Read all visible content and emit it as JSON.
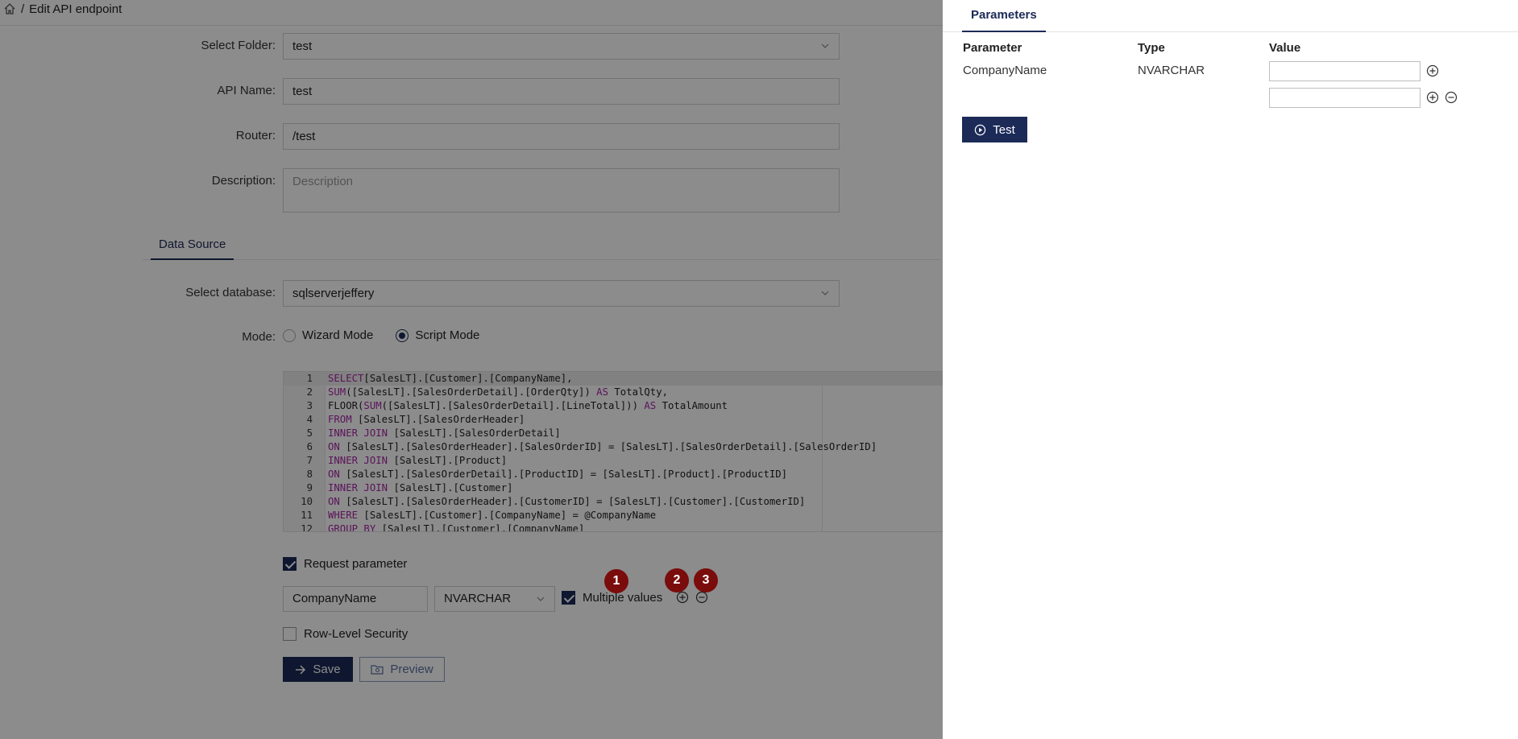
{
  "breadcrumb": {
    "separator": "/",
    "current": "Edit API endpoint"
  },
  "form": {
    "folder": {
      "label": "Select Folder",
      "value": "test"
    },
    "api_name": {
      "label": "API Name",
      "value": "test"
    },
    "router": {
      "label": "Router",
      "value": "/test"
    },
    "description": {
      "label": "Description",
      "placeholder": "Description"
    },
    "tab": "Data Source",
    "database": {
      "label": "Select database",
      "value": "sqlserverjeffery"
    },
    "mode": {
      "label": "Mode",
      "options": [
        "Wizard Mode",
        "Script Mode"
      ],
      "selected": "Script Mode"
    }
  },
  "code": {
    "lines": [
      {
        "n": "1",
        "parts": [
          [
            "kw",
            "SELECT"
          ],
          [
            "",
            "[SalesLT].[Customer].[CompanyName],"
          ]
        ]
      },
      {
        "n": "2",
        "parts": [
          [
            "kw",
            "SUM"
          ],
          [
            "",
            "([SalesLT].[SalesOrderDetail].[OrderQty]) "
          ],
          [
            "kw",
            "AS"
          ],
          [
            "",
            " TotalQty,"
          ]
        ]
      },
      {
        "n": "3",
        "parts": [
          [
            "",
            "FLOOR("
          ],
          [
            "kw",
            "SUM"
          ],
          [
            "",
            "([SalesLT].[SalesOrderDetail].[LineTotal])) "
          ],
          [
            "kw",
            "AS"
          ],
          [
            "",
            " TotalAmount"
          ]
        ]
      },
      {
        "n": "4",
        "parts": [
          [
            "kw",
            "FROM"
          ],
          [
            "",
            " [SalesLT].[SalesOrderHeader]"
          ]
        ]
      },
      {
        "n": "5",
        "parts": [
          [
            "kw",
            "INNER JOIN"
          ],
          [
            "",
            " [SalesLT].[SalesOrderDetail]"
          ]
        ]
      },
      {
        "n": "6",
        "parts": [
          [
            "kw",
            "ON"
          ],
          [
            "",
            " [SalesLT].[SalesOrderHeader].[SalesOrderID] = [SalesLT].[SalesOrderDetail].[SalesOrderID]"
          ]
        ]
      },
      {
        "n": "7",
        "parts": [
          [
            "kw",
            "INNER JOIN"
          ],
          [
            "",
            " [SalesLT].[Product]"
          ]
        ]
      },
      {
        "n": "8",
        "parts": [
          [
            "kw",
            "ON"
          ],
          [
            "",
            " [SalesLT].[SalesOrderDetail].[ProductID] = [SalesLT].[Product].[ProductID]"
          ]
        ]
      },
      {
        "n": "9",
        "parts": [
          [
            "kw",
            "INNER JOIN"
          ],
          [
            "",
            " [SalesLT].[Customer]"
          ]
        ]
      },
      {
        "n": "10",
        "parts": [
          [
            "kw",
            "ON"
          ],
          [
            "",
            " [SalesLT].[SalesOrderHeader].[CustomerID] = [SalesLT].[Customer].[CustomerID]"
          ]
        ]
      },
      {
        "n": "11",
        "parts": [
          [
            "kw",
            "WHERE"
          ],
          [
            "",
            " [SalesLT].[Customer].[CompanyName] = @CompanyName"
          ]
        ]
      },
      {
        "n": "12",
        "parts": [
          [
            "kw",
            "GROUP BY"
          ],
          [
            "",
            " [SalesLT].[Customer].[CompanyName]"
          ]
        ]
      }
    ]
  },
  "request_parameter": {
    "label": "Request parameter",
    "checked": true,
    "param_name": "CompanyName",
    "param_type": "NVARCHAR",
    "multiple_label": "Multiple values",
    "multiple_checked": true
  },
  "row_level_security": {
    "label": "Row-Level Security",
    "checked": false
  },
  "buttons": {
    "save": "Save",
    "preview": "Preview",
    "test": "Test"
  },
  "badges": [
    "1",
    "2",
    "3"
  ],
  "panel": {
    "tab": "Parameters",
    "headers": {
      "parameter": "Parameter",
      "type": "Type",
      "value": "Value"
    },
    "row": {
      "parameter": "CompanyName",
      "type": "NVARCHAR"
    }
  },
  "colors": {
    "accent": "#1b2a57",
    "badge": "#7a0c0c",
    "keyword": "#a626a4"
  }
}
